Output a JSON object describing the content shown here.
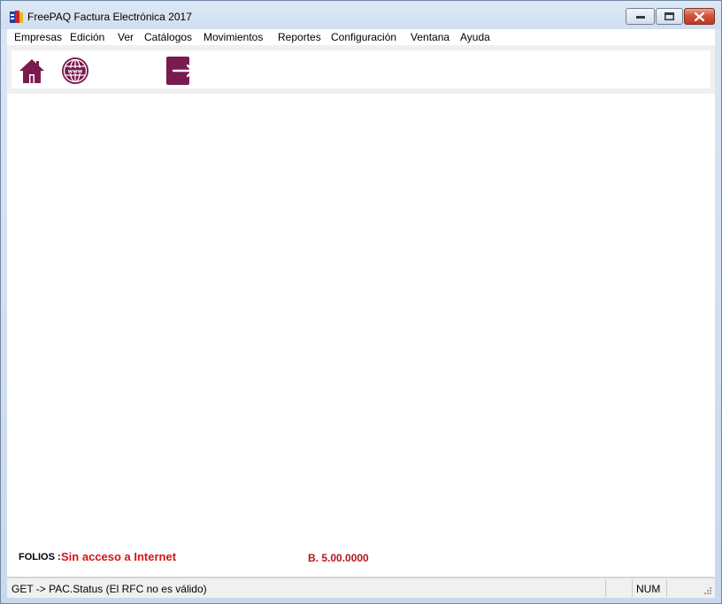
{
  "window": {
    "title": "FreePAQ Factura Electrónica 2017"
  },
  "menu": [
    {
      "label": "Empresas"
    },
    {
      "label": "Edición"
    },
    {
      "label": "Ver"
    },
    {
      "label": "Catálogos"
    },
    {
      "label": "Movimientos"
    },
    {
      "label": "Reportes"
    },
    {
      "label": "Configuración"
    },
    {
      "label": "Ventana"
    },
    {
      "label": "Ayuda"
    }
  ],
  "toolbar": {
    "icons": [
      "home-icon",
      "globe-icon",
      "exit-icon"
    ],
    "accent_color": "#7a1a4e"
  },
  "content": {
    "folios_label": "FOLIOS :",
    "folios_value": "Sin acceso a Internet",
    "version": "B. 5.00.0000"
  },
  "statusbar": {
    "message": "GET -> PAC.Status (El RFC no es válido)",
    "num_indicator": "NUM"
  }
}
